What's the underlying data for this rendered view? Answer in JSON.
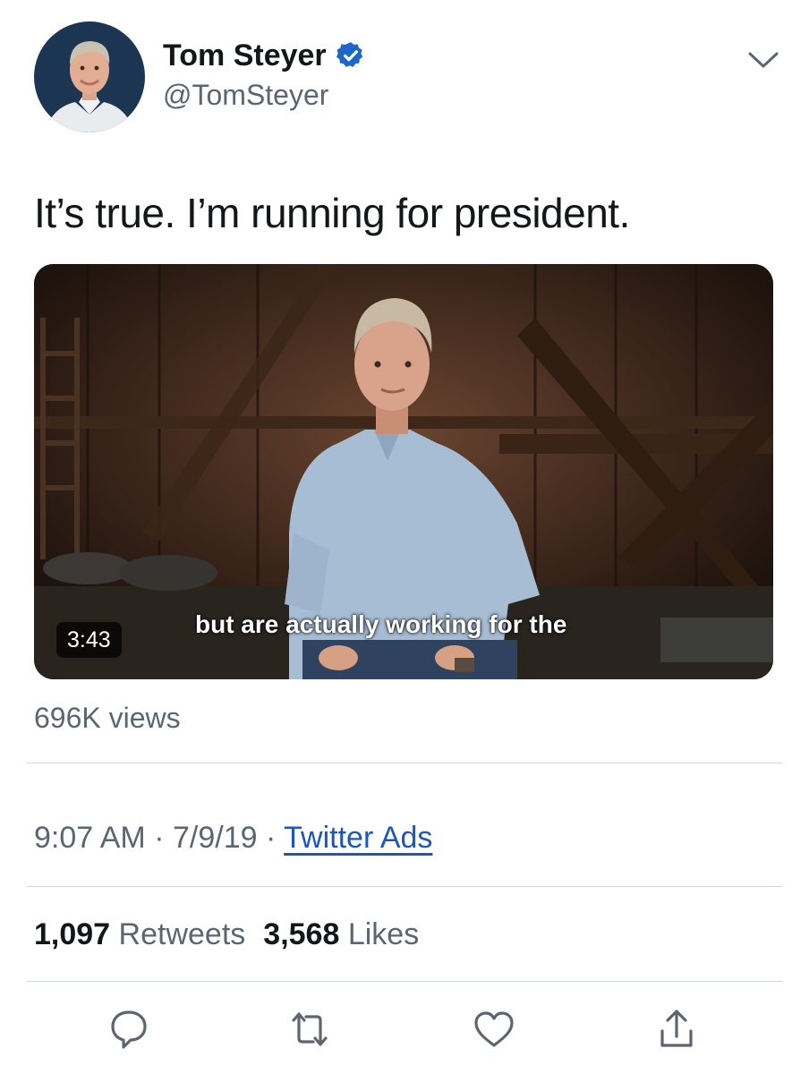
{
  "author": {
    "display_name": "Tom Steyer",
    "handle": "@TomSteyer",
    "verified_icon": "verified-badge-icon",
    "menu_icon": "chevron-down-icon"
  },
  "tweet": {
    "text": "It’s true. I’m running for president."
  },
  "video": {
    "duration": "3:43",
    "caption": "but are actually working for the",
    "views": "696K views"
  },
  "meta": {
    "time": "9:07 AM",
    "separator": "·",
    "date": "7/9/19",
    "source": "Twitter Ads"
  },
  "stats": {
    "retweets_count": "1,097",
    "retweets_label": "Retweets",
    "likes_count": "3,568",
    "likes_label": "Likes"
  },
  "actions": [
    "reply-icon",
    "retweet-icon",
    "like-icon",
    "share-icon"
  ],
  "colors": {
    "text": "#14171a",
    "secondary": "#5b6670",
    "link": "#1b58b8",
    "verified": "#1d67c9",
    "divider": "#d0d6db"
  }
}
